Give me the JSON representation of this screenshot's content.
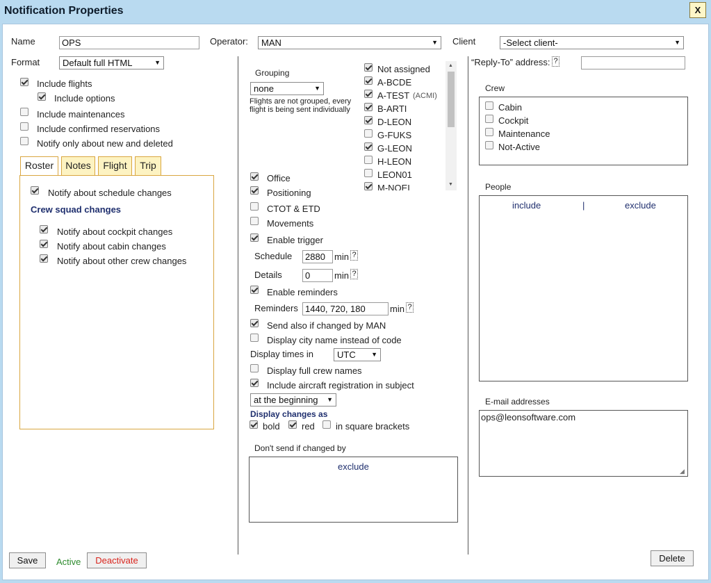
{
  "window": {
    "title": "Notification Properties",
    "close_label": "X"
  },
  "form": {
    "name_label": "Name",
    "name_value": "OPS",
    "operator_label": "Operator:",
    "operator_value": "MAN",
    "client_label": "Client",
    "client_value": "-Select client-",
    "format_label": "Format",
    "format_value": "Default full HTML"
  },
  "left_options": {
    "include_flights": {
      "label": "Include flights",
      "checked": true
    },
    "include_options": {
      "label": "Include options",
      "checked": true
    },
    "include_maintenances": {
      "label": "Include maintenances",
      "checked": false
    },
    "include_confirmed_reservations": {
      "label": "Include confirmed reservations",
      "checked": false
    },
    "notify_new_deleted": {
      "label": "Notify only about new and deleted",
      "checked": false
    }
  },
  "tabs": [
    "Roster",
    "Notes",
    "Flight",
    "Trip"
  ],
  "roster": {
    "notify_schedule": {
      "label": "Notify about schedule changes",
      "checked": true
    },
    "crew_squad_heading": "Crew squad changes",
    "notify_cockpit": {
      "label": "Notify about cockpit changes",
      "checked": true
    },
    "notify_cabin": {
      "label": "Notify about cabin changes",
      "checked": true
    },
    "notify_other_crew": {
      "label": "Notify about other crew changes",
      "checked": true
    }
  },
  "middle": {
    "grouping_label": "Grouping",
    "grouping_value": "none",
    "grouping_note": "Flights are not grouped, every flight is being sent individually",
    "aircraft": [
      {
        "label": "Not assigned",
        "checked": true,
        "tag": ""
      },
      {
        "label": "A-BCDE",
        "checked": true,
        "tag": ""
      },
      {
        "label": "A-TEST",
        "checked": true,
        "tag": "(ACMI)"
      },
      {
        "label": "B-ARTI",
        "checked": true,
        "tag": ""
      },
      {
        "label": "D-LEON",
        "checked": true,
        "tag": ""
      },
      {
        "label": "G-FUKS",
        "checked": false,
        "tag": ""
      },
      {
        "label": "G-LEON",
        "checked": true,
        "tag": ""
      },
      {
        "label": "H-LEON",
        "checked": false,
        "tag": ""
      },
      {
        "label": "LEON01",
        "checked": false,
        "tag": ""
      },
      {
        "label": "M-NOEL",
        "checked": true,
        "tag": ""
      }
    ],
    "office": {
      "label": "Office",
      "checked": true
    },
    "positioning": {
      "label": "Positioning",
      "checked": true
    },
    "ctot_etd": {
      "label": "CTOT & ETD",
      "checked": false
    },
    "movements": {
      "label": "Movements",
      "checked": false
    },
    "enable_trigger": {
      "label": "Enable trigger",
      "checked": true
    },
    "schedule_label": "Schedule",
    "schedule_value": "2880",
    "details_label": "Details",
    "details_value": "0",
    "min_label": "min",
    "help_label": "?",
    "enable_reminders": {
      "label": "Enable reminders",
      "checked": true
    },
    "reminders_label": "Reminders",
    "reminders_value": "1440, 720, 180",
    "send_if_changed": {
      "label": "Send also if changed by MAN",
      "checked": true
    },
    "display_city": {
      "label": "Display city name instead of code",
      "checked": false
    },
    "display_times_label": "Display times in",
    "display_times_value": "UTC",
    "display_full_crew": {
      "label": "Display full crew names",
      "checked": false
    },
    "include_registration": {
      "label": "Include aircraft registration in subject",
      "checked": true
    },
    "registration_position_value": "at the beginning",
    "display_changes_label": "Display changes as",
    "bold": {
      "label": "bold",
      "checked": true
    },
    "red": {
      "label": "red",
      "checked": true
    },
    "square_brackets": {
      "label": "in square brackets",
      "checked": false
    },
    "dont_send_label": "Don't send if changed by",
    "dont_send_exclude": "exclude"
  },
  "right": {
    "reply_to_label": "“Reply-To” address:",
    "reply_to_value": "",
    "crew_label": "Crew",
    "crew": [
      {
        "label": "Cabin",
        "checked": false
      },
      {
        "label": "Cockpit",
        "checked": false
      },
      {
        "label": "Maintenance",
        "checked": false
      },
      {
        "label": "Not-Active",
        "checked": false
      }
    ],
    "people_label": "People",
    "people_include": "include",
    "people_separator": "|",
    "people_exclude": "exclude",
    "email_label": "E-mail addresses",
    "email_value": "ops@leonsoftware.com"
  },
  "footer": {
    "save_label": "Save",
    "status": "Active",
    "deactivate_label": "Deactivate",
    "delete_label": "Delete"
  },
  "colors": {
    "active": "#2e8b2e",
    "deactivate": "#d9241c",
    "link_text": "#1f2f6e",
    "tab_border": "#d9a640"
  }
}
